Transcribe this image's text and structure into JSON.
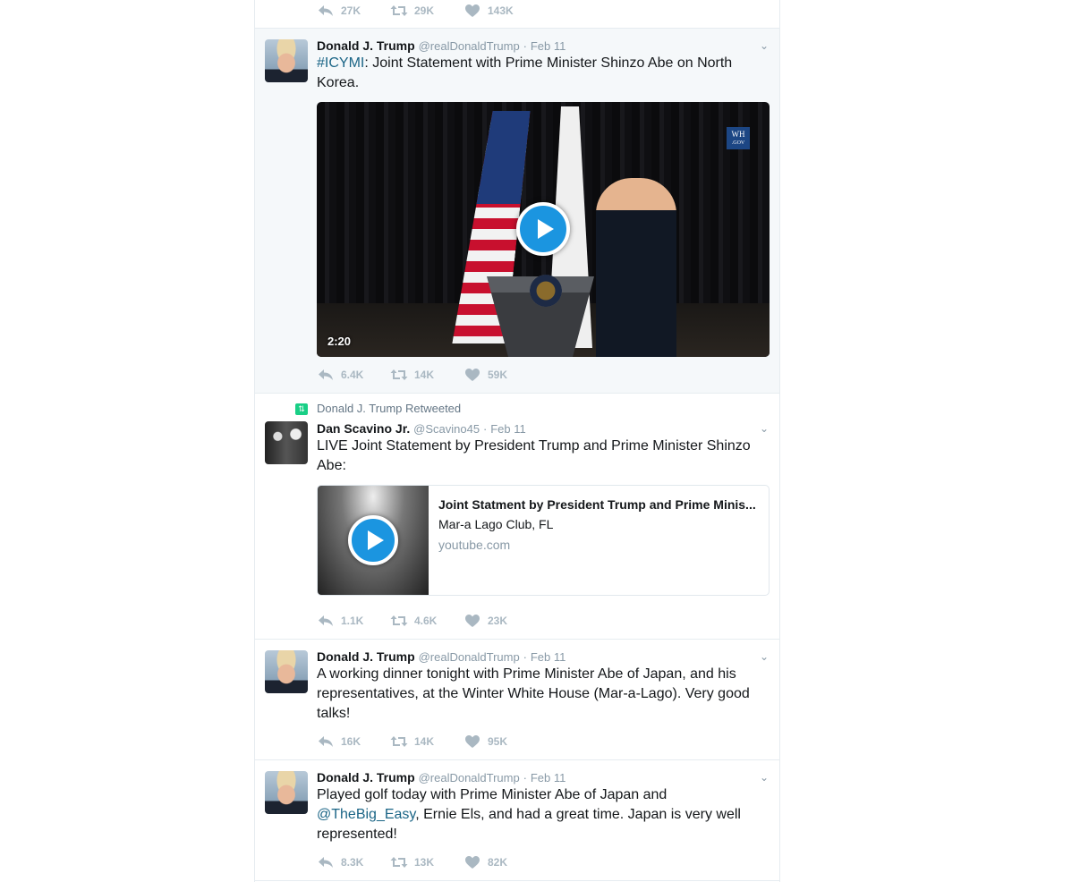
{
  "colors": {
    "accent": "#1b95e0",
    "link": "#1b6586",
    "retweet": "#19cf86",
    "muted": "#aab8c2"
  },
  "top_card": {
    "actions": {
      "replies": "27K",
      "retweets": "29K",
      "likes": "143K"
    }
  },
  "tweets": [
    {
      "name": "Donald J. Trump",
      "handle": "@realDonaldTrump",
      "sep": "·",
      "time": "Feb 11",
      "hashtag": "#ICYMI",
      "text": ": Joint Statement with Prime Minister Shinzo Abe on North Korea.",
      "video": {
        "duration": "2:20",
        "watermark_top": "WH",
        "watermark_bottom": ".GOV"
      },
      "actions": {
        "replies": "6.4K",
        "retweets": "14K",
        "likes": "59K"
      }
    },
    {
      "context": "Donald J. Trump Retweeted",
      "name": "Dan Scavino Jr.",
      "handle": "@Scavino45",
      "sep": "·",
      "time": "Feb 11",
      "text": "LIVE Joint Statement by President Trump and Prime Minister Shinzo Abe:",
      "card": {
        "title": "Joint Statment by President Trump and Prime Minis...",
        "description": "Mar-a Lago Club, FL",
        "domain": "youtube.com"
      },
      "actions": {
        "replies": "1.1K",
        "retweets": "4.6K",
        "likes": "23K"
      }
    },
    {
      "name": "Donald J. Trump",
      "handle": "@realDonaldTrump",
      "sep": "·",
      "time": "Feb 11",
      "text": "A working dinner tonight with Prime Minister Abe of Japan, and his representatives, at the Winter White House (Mar-a-Lago). Very good talks!",
      "actions": {
        "replies": "16K",
        "retweets": "14K",
        "likes": "95K"
      }
    },
    {
      "name": "Donald J. Trump",
      "handle": "@realDonaldTrump",
      "sep": "·",
      "time": "Feb 11",
      "text_before": "Played golf today with Prime Minister Abe of Japan and ",
      "mention": "@TheBig_Easy",
      "text_after": ", Ernie Els, and had a great time. Japan is very well represented!",
      "actions": {
        "replies": "8.3K",
        "retweets": "13K",
        "likes": "82K"
      }
    }
  ]
}
